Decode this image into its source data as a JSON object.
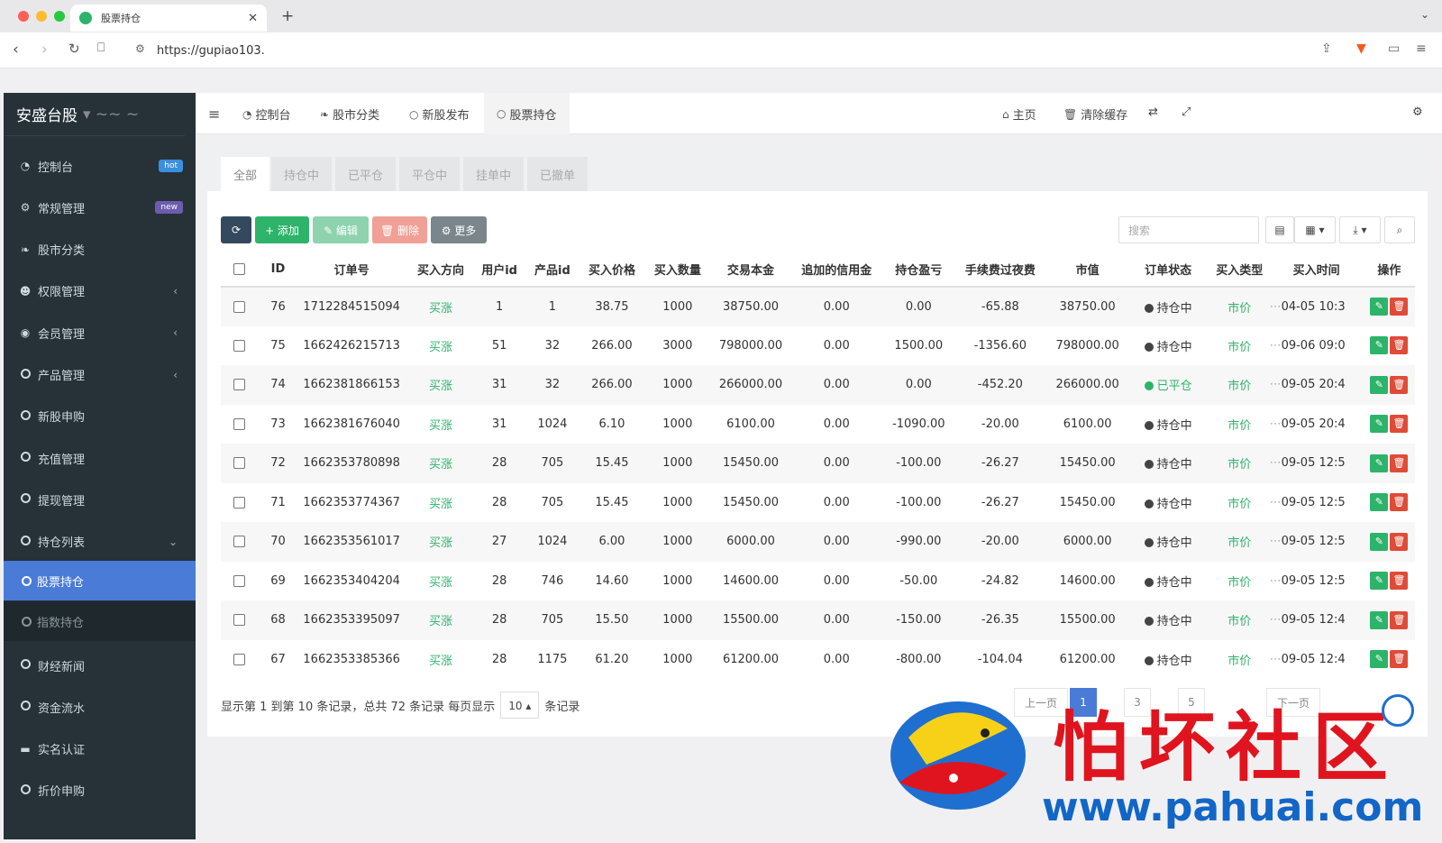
{
  "browser": {
    "tab_title": "股票持仓",
    "url": "https://gupiao103."
  },
  "sidebar": {
    "brand": "安盛台股",
    "items": [
      {
        "label": "控制台",
        "badge": "hot",
        "icon": "dashboard-icon"
      },
      {
        "label": "常规管理",
        "badge": "new",
        "icon": "cogs-icon"
      },
      {
        "label": "股市分类",
        "icon": "leaf-icon"
      },
      {
        "label": "权限管理",
        "icon": "users-icon",
        "arrow": "‹"
      },
      {
        "label": "会员管理",
        "icon": "user-circle-icon",
        "arrow": "‹"
      },
      {
        "label": "产品管理",
        "icon": "circle-icon",
        "arrow": "‹"
      },
      {
        "label": "新股申购",
        "icon": "circle-icon"
      },
      {
        "label": "充值管理",
        "icon": "circle-icon"
      },
      {
        "label": "提现管理",
        "icon": "circle-icon"
      },
      {
        "label": "持仓列表",
        "icon": "circle-icon",
        "arrow": "⌄"
      }
    ],
    "sub_items": [
      {
        "label": "股票持仓",
        "active": true
      },
      {
        "label": "指数持仓",
        "active": false
      }
    ],
    "items_after": [
      {
        "label": "财经新闻",
        "icon": "circle-icon"
      },
      {
        "label": "资金流水",
        "icon": "circle-icon"
      },
      {
        "label": "实名认证",
        "icon": "credit-card-icon"
      },
      {
        "label": "折价申购",
        "icon": "circle-icon"
      }
    ]
  },
  "topnav": {
    "tabs": [
      "控制台",
      "股市分类",
      "新股发布",
      "股票持仓"
    ],
    "home": "主页",
    "clear_cache": "清除缓存"
  },
  "subtabs": [
    "全部",
    "持仓中",
    "已平仓",
    "平仓中",
    "挂单中",
    "已撤单"
  ],
  "toolbar": {
    "refresh": "⟳",
    "add": "+ 添加",
    "edit": "✎ 编辑",
    "delete": "🗑 删除",
    "more": "⚙ 更多",
    "search_placeholder": "搜索"
  },
  "table": {
    "columns": [
      "ID",
      "订单号",
      "买入方向",
      "用户id",
      "产品id",
      "买入价格",
      "买入数量",
      "交易本金",
      "追加的信用金",
      "持仓盈亏",
      "手续费过夜费",
      "市值",
      "订单状态",
      "买入类型",
      "买入时间",
      "操作"
    ],
    "rows": [
      {
        "id": "76",
        "order": "1712284515094",
        "dir": "买涨",
        "uid": "1",
        "pid": "1",
        "price": "38.75",
        "qty": "1000",
        "principal": "38750.00",
        "credit": "0.00",
        "pnl": "0.00",
        "fee": "-65.88",
        "mv": "38750.00",
        "status": "持仓中",
        "status_color": "#444444",
        "type": "市价",
        "time": "04-05 10:3"
      },
      {
        "id": "75",
        "order": "1662426215713",
        "dir": "买涨",
        "uid": "51",
        "pid": "32",
        "price": "266.00",
        "qty": "3000",
        "principal": "798000.00",
        "credit": "0.00",
        "pnl": "1500.00",
        "fee": "-1356.60",
        "mv": "798000.00",
        "status": "持仓中",
        "status_color": "#444444",
        "type": "市价",
        "time": "09-06 09:0"
      },
      {
        "id": "74",
        "order": "1662381866153",
        "dir": "买涨",
        "uid": "31",
        "pid": "32",
        "price": "266.00",
        "qty": "1000",
        "principal": "266000.00",
        "credit": "0.00",
        "pnl": "0.00",
        "fee": "-452.20",
        "mv": "266000.00",
        "status": "已平仓",
        "status_color": "#2db36a",
        "type": "市价",
        "time": "09-05 20:4"
      },
      {
        "id": "73",
        "order": "1662381676040",
        "dir": "买涨",
        "uid": "31",
        "pid": "1024",
        "price": "6.10",
        "qty": "1000",
        "principal": "6100.00",
        "credit": "0.00",
        "pnl": "-1090.00",
        "fee": "-20.00",
        "mv": "6100.00",
        "status": "持仓中",
        "status_color": "#444444",
        "type": "市价",
        "time": "09-05 20:4"
      },
      {
        "id": "72",
        "order": "1662353780898",
        "dir": "买涨",
        "uid": "28",
        "pid": "705",
        "price": "15.45",
        "qty": "1000",
        "principal": "15450.00",
        "credit": "0.00",
        "pnl": "-100.00",
        "fee": "-26.27",
        "mv": "15450.00",
        "status": "持仓中",
        "status_color": "#444444",
        "type": "市价",
        "time": "09-05 12:5"
      },
      {
        "id": "71",
        "order": "1662353774367",
        "dir": "买涨",
        "uid": "28",
        "pid": "705",
        "price": "15.45",
        "qty": "1000",
        "principal": "15450.00",
        "credit": "0.00",
        "pnl": "-100.00",
        "fee": "-26.27",
        "mv": "15450.00",
        "status": "持仓中",
        "status_color": "#444444",
        "type": "市价",
        "time": "09-05 12:5"
      },
      {
        "id": "70",
        "order": "1662353561017",
        "dir": "买涨",
        "uid": "27",
        "pid": "1024",
        "price": "6.00",
        "qty": "1000",
        "principal": "6000.00",
        "credit": "0.00",
        "pnl": "-990.00",
        "fee": "-20.00",
        "mv": "6000.00",
        "status": "持仓中",
        "status_color": "#444444",
        "type": "市价",
        "time": "09-05 12:5"
      },
      {
        "id": "69",
        "order": "1662353404204",
        "dir": "买涨",
        "uid": "28",
        "pid": "746",
        "price": "14.60",
        "qty": "1000",
        "principal": "14600.00",
        "credit": "0.00",
        "pnl": "-50.00",
        "fee": "-24.82",
        "mv": "14600.00",
        "status": "持仓中",
        "status_color": "#444444",
        "type": "市价",
        "time": "09-05 12:5"
      },
      {
        "id": "68",
        "order": "1662353395097",
        "dir": "买涨",
        "uid": "28",
        "pid": "705",
        "price": "15.50",
        "qty": "1000",
        "principal": "15500.00",
        "credit": "0.00",
        "pnl": "-150.00",
        "fee": "-26.35",
        "mv": "15500.00",
        "status": "持仓中",
        "status_color": "#444444",
        "type": "市价",
        "time": "09-05 12:4"
      },
      {
        "id": "67",
        "order": "1662353385366",
        "dir": "买涨",
        "uid": "28",
        "pid": "1175",
        "price": "61.20",
        "qty": "1000",
        "principal": "61200.00",
        "credit": "0.00",
        "pnl": "-800.00",
        "fee": "-104.04",
        "mv": "61200.00",
        "status": "持仓中",
        "status_color": "#444444",
        "type": "市价",
        "time": "09-05 12:4"
      }
    ]
  },
  "footer": {
    "summary": "显示第 1 到第 10 条记录，总共 72 条记录 每页显示",
    "per_page": "10 ▴",
    "suffix": "条记录"
  },
  "pagination": [
    "上一页",
    "1",
    "3",
    "5",
    "下一页"
  ],
  "watermark": {
    "text": "怕坏社区",
    "url": "www.pahuai.com"
  }
}
